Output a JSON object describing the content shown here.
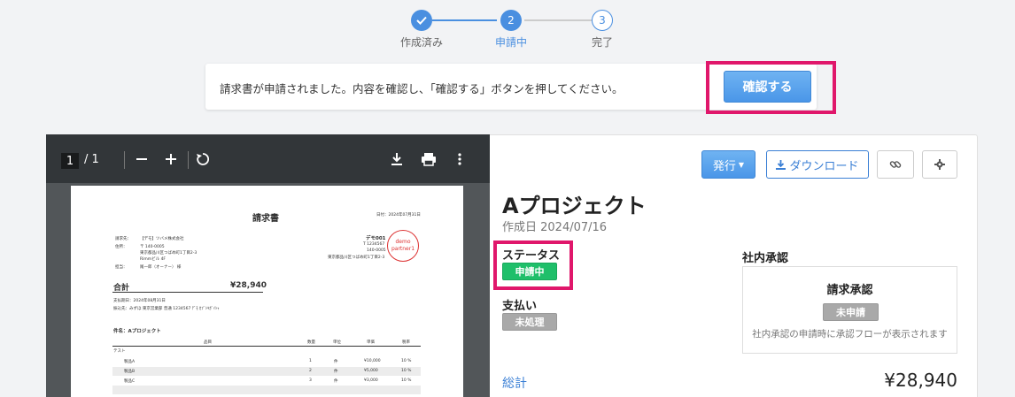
{
  "stepper": {
    "steps": [
      {
        "num": "",
        "label": "作成済み"
      },
      {
        "num": "2",
        "label": "申請中"
      },
      {
        "num": "3",
        "label": "完了"
      }
    ]
  },
  "notice": {
    "message": "請求書が申請されました。内容を確認し、「確認する」ボタンを押してください。",
    "confirm_label": "確認する"
  },
  "pdf_viewer": {
    "page_current": "1",
    "page_total": "/ 1",
    "document": {
      "title": "請求書",
      "date": "日付：2024年07月31日",
      "to_label": "請求先：",
      "to_name": "【デモ】ツバメ株式会社",
      "addr_label": "住所：",
      "addr_zip": "〒 140-0005",
      "addr_line1": "東京都品川区つばめ町1丁目2-3",
      "addr_line2": "Rimmビル 4F",
      "person_label": "担当：",
      "person_name": "尾一郎（オーナー） 様",
      "issuer_name": "デモ001",
      "issuer_tel": "T 1234567",
      "issuer_zip": "140-0005",
      "issuer_addr": "東京都品川区つばめ町1丁目2-3",
      "stamp_line1": "demo",
      "stamp_line2": "partner1",
      "total_label": "合計",
      "total_value": "¥28,940",
      "due": "支払期日：2024年08月31日",
      "bank": "振込先：みずほ 東京営業部 普通 1234567 ﾃﾞﾓ ｶﾌﾞｼｷｶﾞｲｼｬ",
      "subject": "件名：Aプロジェクト",
      "col_item": "品目",
      "col_qty": "数量",
      "col_unit": "単位",
      "col_price": "単価",
      "col_tax": "税率",
      "section": "テスト",
      "rows": [
        {
          "item": "製品A",
          "qty": "1",
          "unit": "件",
          "price": "¥10,000",
          "tax": "10 %"
        },
        {
          "item": "製品B",
          "qty": "2",
          "unit": "件",
          "price": "¥5,000",
          "tax": "10 %"
        },
        {
          "item": "製品C",
          "qty": "3",
          "unit": "件",
          "price": "¥3,000",
          "tax": "10 %"
        }
      ]
    }
  },
  "actions": {
    "issue_label": "発行",
    "download_label": "ダウンロード"
  },
  "detail": {
    "project_title": "Aプロジェクト",
    "created": "作成日 2024/07/16",
    "status_label": "ステータス",
    "status_value": "申請中",
    "payment_label": "支払い",
    "payment_value": "未処理",
    "internal_label": "社内承認",
    "approval_title": "請求承認",
    "approval_status": "未申請",
    "approval_note": "社内承認の申請時に承認フローが表示されます",
    "total_label": "総計",
    "total_value": "¥28,940"
  }
}
